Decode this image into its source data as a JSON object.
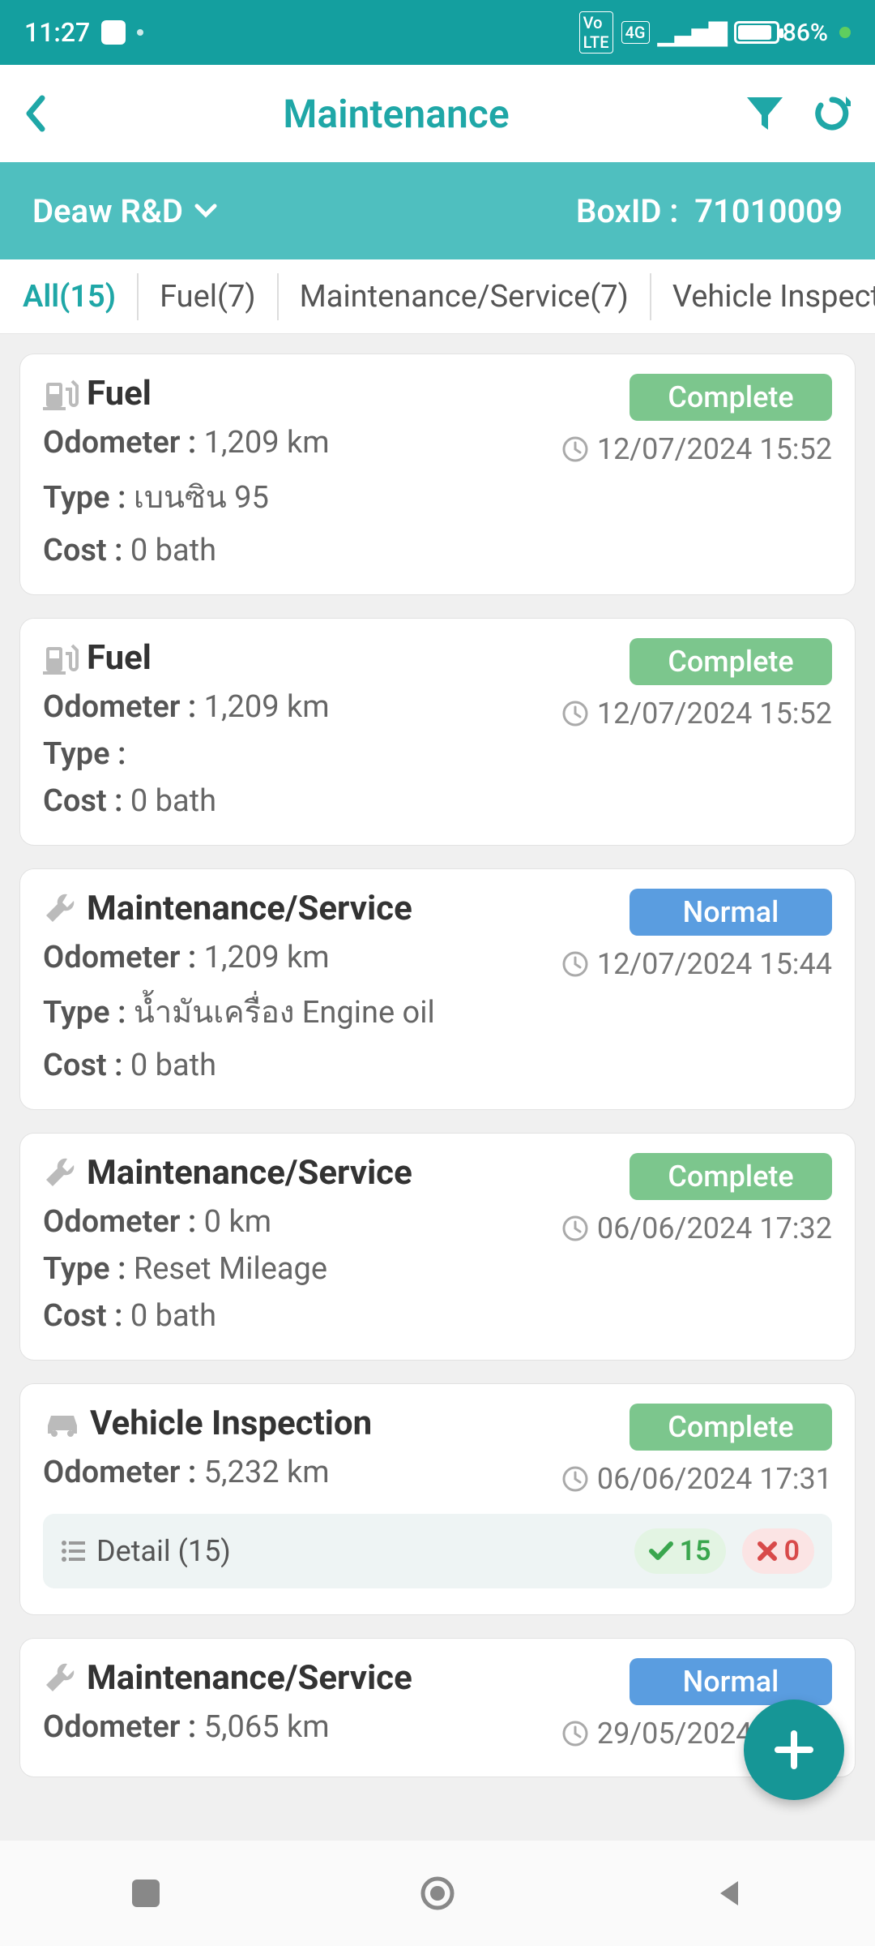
{
  "status": {
    "time": "11:27",
    "battery": "86",
    "net": "4G"
  },
  "header": {
    "title": "Maintenance",
    "vehicle": "Deaw R&D",
    "box_label": "BoxID :",
    "box_id": "71010009"
  },
  "tabs": [
    {
      "label": "All(15)",
      "active": true
    },
    {
      "label": "Fuel(7)"
    },
    {
      "label": "Maintenance/Service(7)"
    },
    {
      "label": "Vehicle Inspection("
    }
  ],
  "labels": {
    "odometer": "Odometer :",
    "type": "Type :",
    "cost": "Cost :"
  },
  "cards": [
    {
      "icon": "fuel",
      "title": "Fuel",
      "badge": "Complete",
      "badge_color": "green",
      "timestamp": "12/07/2024 15:52",
      "odometer": "1,209 km",
      "type": "เบนซิน 95",
      "cost": "0 bath"
    },
    {
      "icon": "fuel",
      "title": "Fuel",
      "badge": "Complete",
      "badge_color": "green",
      "timestamp": "12/07/2024 15:52",
      "odometer": "1,209 km",
      "type": "",
      "cost": "0 bath"
    },
    {
      "icon": "wrench",
      "title": "Maintenance/Service",
      "badge": "Normal",
      "badge_color": "blue",
      "timestamp": "12/07/2024 15:44",
      "odometer": "1,209 km",
      "type": "น้ำมันเครื่อง Engine oil",
      "cost": "0 bath"
    },
    {
      "icon": "wrench",
      "title": "Maintenance/Service",
      "badge": "Complete",
      "badge_color": "green",
      "timestamp": "06/06/2024 17:32",
      "odometer": "0 km",
      "type": "Reset Mileage",
      "cost": "0 bath"
    },
    {
      "icon": "car",
      "title": "Vehicle Inspection",
      "badge": "Complete",
      "badge_color": "green",
      "timestamp": "06/06/2024 17:31",
      "odometer": "5,232 km",
      "detail": {
        "label": "Detail (15)",
        "pass": "15",
        "fail": "0"
      }
    },
    {
      "icon": "wrench",
      "title": "Maintenance/Service",
      "badge": "Normal",
      "badge_color": "blue",
      "timestamp": "29/05/2024 14:31",
      "odometer": "5,065 km"
    }
  ]
}
